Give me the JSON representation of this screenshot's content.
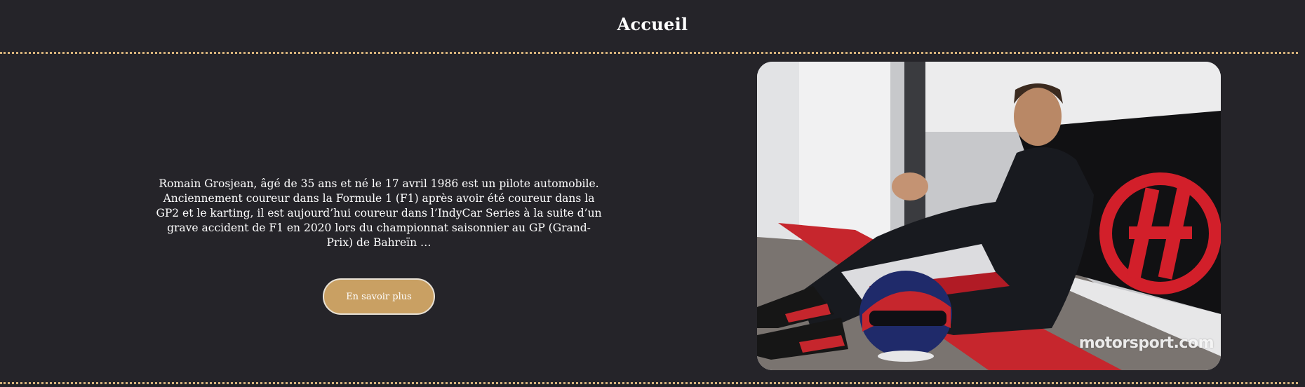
{
  "header": {
    "title": "Accueil"
  },
  "intro": {
    "text": "Romain Grosjean, âgé de 35 ans et né le 17 avril 1986 est un pilote automobile. Anciennement coureur dans la Formule 1 (F1) après avoir été coureur dans la GP2 et le karting, il est aujourd’hui coureur dans l’IndyCar Series à la suite d’un grave accident de F1 en 2020 lors du championnat saisonnier au GP (Grand-Prix) de Bahreïn …",
    "button_label": "En savoir plus"
  },
  "photo": {
    "watermark": "motorsport.com"
  },
  "colors": {
    "background": "#252429",
    "accent": "#c9a063",
    "divider": "#d6b27a",
    "text": "#ffffff"
  }
}
